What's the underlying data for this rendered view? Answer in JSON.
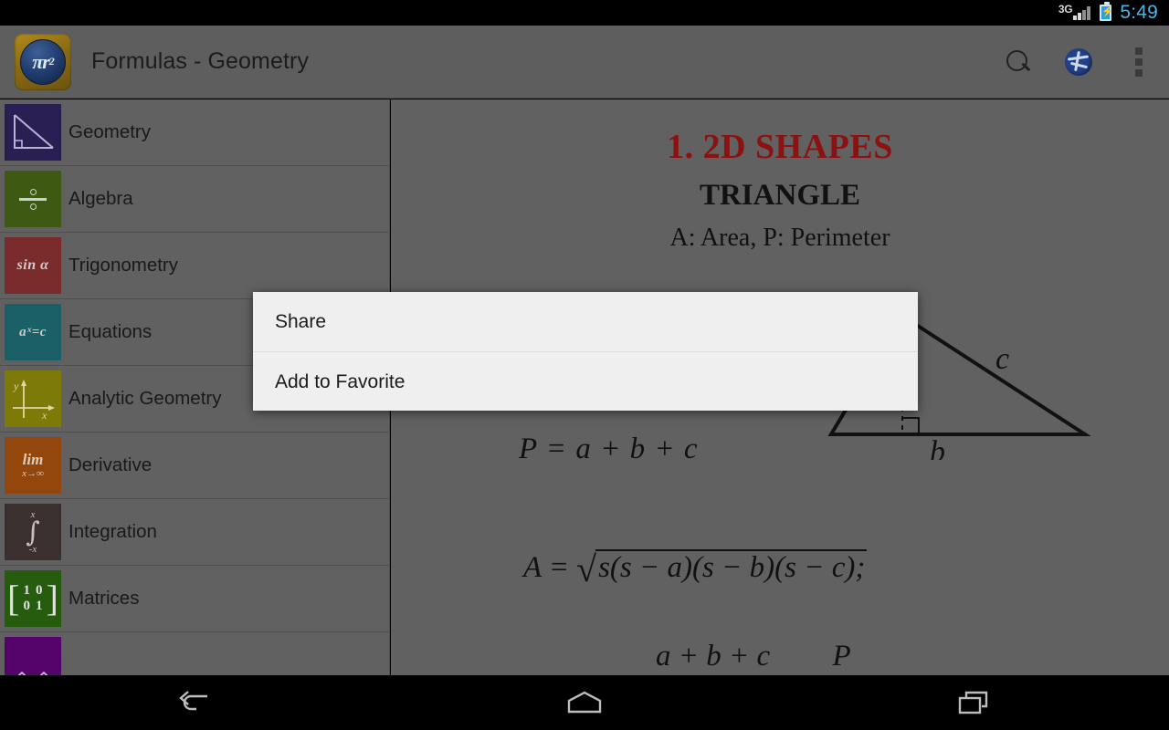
{
  "statusbar": {
    "network": "3G",
    "time": "5:49",
    "battery_icon": "battery-charging-icon",
    "signal_icon": "signal-bars-icon"
  },
  "actionbar": {
    "app_icon": "app-logo-pi-r-squared",
    "app_icon_text": "πr",
    "app_icon_exp": "2",
    "title": "Formulas - Geometry",
    "actions": [
      {
        "name": "search-icon",
        "label": "Search"
      },
      {
        "name": "globe-icon",
        "label": "Web"
      },
      {
        "name": "overflow-menu-icon",
        "label": "More options"
      }
    ]
  },
  "sidebar": {
    "items": [
      {
        "label": "Geometry",
        "icon": "right-triangle-icon",
        "color": "#2a1f52"
      },
      {
        "label": "Algebra",
        "icon": "division-sign-icon",
        "color": "#3e5a12"
      },
      {
        "label": "Trigonometry",
        "icon": "sin-alpha-icon",
        "color": "#7a2b2b",
        "glyph": "sin α"
      },
      {
        "label": "Equations",
        "icon": "exponential-equation-icon",
        "color": "#1b6066",
        "glyph": "aˣ=c"
      },
      {
        "label": "Analytic Geometry",
        "icon": "xy-axes-icon",
        "color": "#7d7a08"
      },
      {
        "label": "Derivative",
        "icon": "limit-icon",
        "color": "#94470c",
        "glyph_top": "lim",
        "glyph_bottom": "x→∞"
      },
      {
        "label": "Integration",
        "icon": "integral-icon",
        "color": "#3b3030",
        "glyph_top": "x",
        "glyph_bottom": "-x"
      },
      {
        "label": "Matrices",
        "icon": "identity-matrix-icon",
        "color": "#265c0d",
        "matrix": [
          [
            "1",
            "0"
          ],
          [
            "0",
            "1"
          ]
        ]
      },
      {
        "label": "",
        "icon": "series-wave-icon",
        "color": "#54046b"
      }
    ]
  },
  "content": {
    "section_title": "1. 2D SHAPES",
    "shape_title": "TRIANGLE",
    "legend": "A: Area, P: Perimeter",
    "formula_perimeter": "P = a + b + c",
    "formula_area_lead": "A =",
    "formula_area_body": "s(s − a)(s − b)(s − c);",
    "formula_third_numerator": "a + b + c",
    "formula_third_right": "P",
    "diagram": {
      "name": "triangle-diagram",
      "label_side_c": "c",
      "label_side_b": "b"
    },
    "title_color": "#8c1212"
  },
  "menu": {
    "items": [
      {
        "label": "Share"
      },
      {
        "label": "Add to Favorite"
      }
    ]
  },
  "navbar": {
    "buttons": [
      {
        "name": "back-icon",
        "label": "Back"
      },
      {
        "name": "home-icon",
        "label": "Home"
      },
      {
        "name": "recents-icon",
        "label": "Recent apps"
      }
    ]
  }
}
